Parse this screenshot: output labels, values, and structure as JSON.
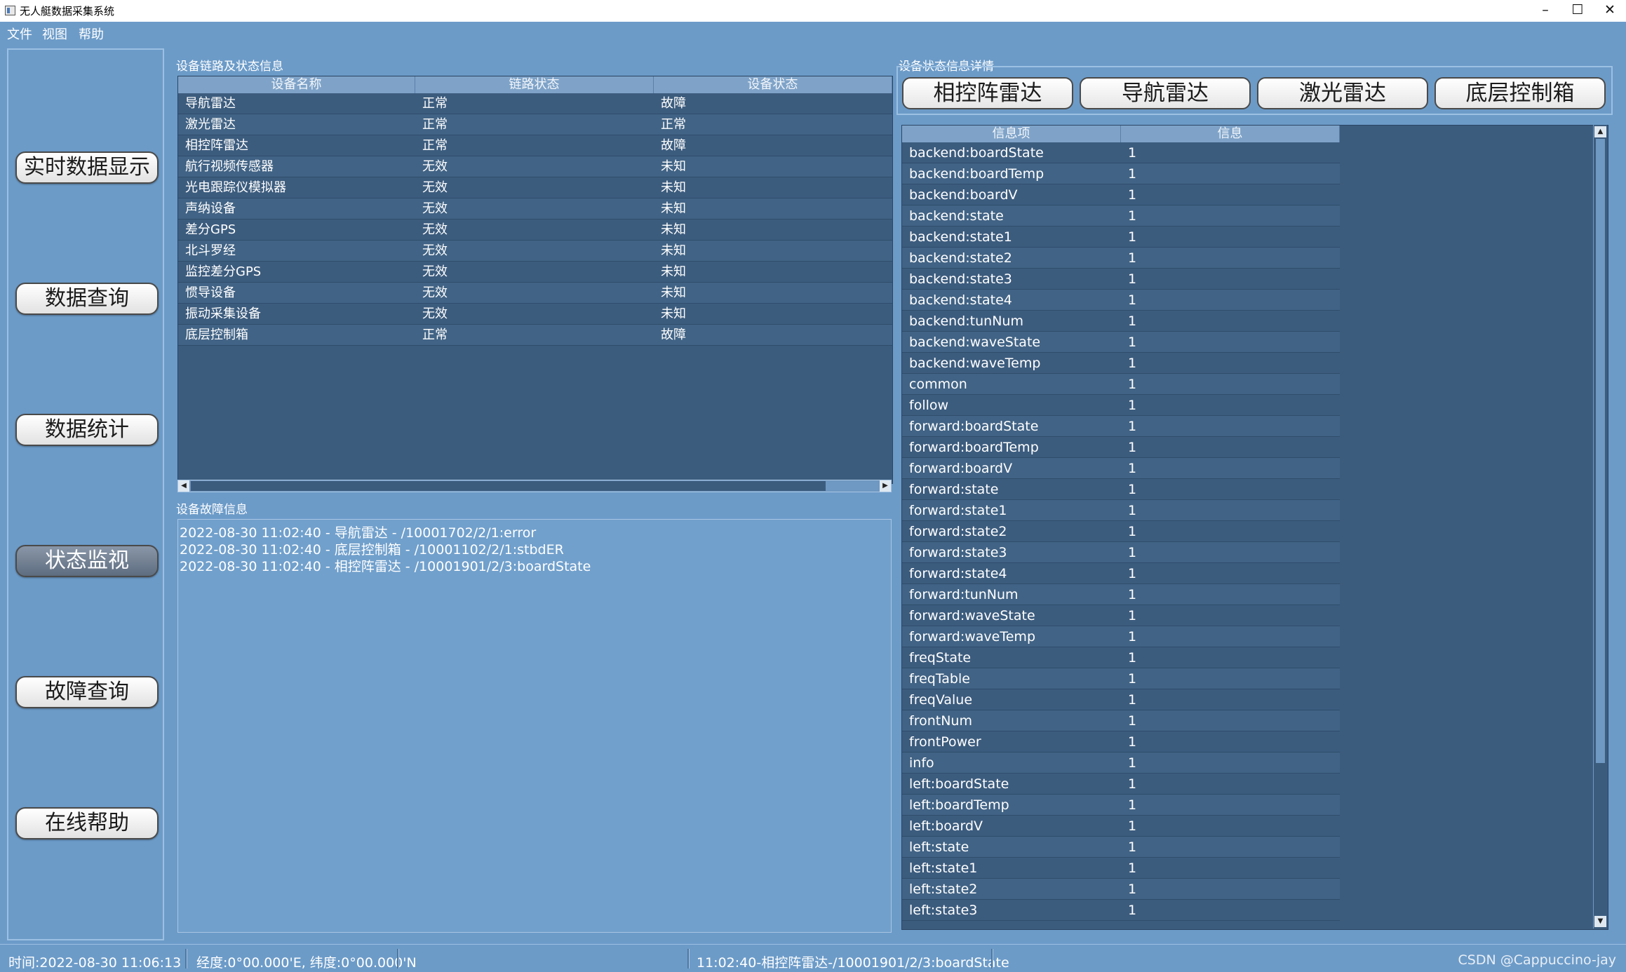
{
  "window": {
    "title": "无人艇数据采集系统",
    "controls": [
      "–",
      "☐",
      "✕"
    ]
  },
  "menu": [
    "文件",
    "视图",
    "帮助"
  ],
  "nav": {
    "buttons": [
      "实时数据显示",
      "数据查询",
      "数据统计",
      "状态监视",
      "故障查询",
      "在线帮助"
    ],
    "active": "状态监视"
  },
  "device_link": {
    "title": "设备链路及状态信息",
    "columns": [
      "设备名称",
      "链路状态",
      "设备状态"
    ],
    "rows": [
      [
        "导航雷达",
        "正常",
        "故障"
      ],
      [
        "激光雷达",
        "正常",
        "正常"
      ],
      [
        "相控阵雷达",
        "正常",
        "故障"
      ],
      [
        "航行视频传感器",
        "无效",
        "未知"
      ],
      [
        "光电跟踪仪模拟器",
        "无效",
        "未知"
      ],
      [
        "声纳设备",
        "无效",
        "未知"
      ],
      [
        "差分GPS",
        "无效",
        "未知"
      ],
      [
        "北斗罗经",
        "无效",
        "未知"
      ],
      [
        "监控差分GPS",
        "无效",
        "未知"
      ],
      [
        "惯导设备",
        "无效",
        "未知"
      ],
      [
        "振动采集设备",
        "无效",
        "未知"
      ],
      [
        "底层控制箱",
        "正常",
        "故障"
      ]
    ]
  },
  "fault_info": {
    "title": "设备故障信息",
    "lines": [
      "2022-08-30 11:02:40 - 导航雷达 - /10001702/2/1:error",
      "2022-08-30 11:02:40 - 底层控制箱 - /10001102/2/1:stbdER",
      "2022-08-30 11:02:40 - 相控阵雷达 - /10001901/2/3:boardState"
    ]
  },
  "detail": {
    "title": "设备状态信息详情",
    "tabs": [
      "相控阵雷达",
      "导航雷达",
      "激光雷达",
      "底层控制箱"
    ],
    "columns": [
      "信息项",
      "信息"
    ],
    "rows": [
      [
        "backend:boardState",
        "1"
      ],
      [
        "backend:boardTemp",
        "1"
      ],
      [
        "backend:boardV",
        "1"
      ],
      [
        "backend:state",
        "1"
      ],
      [
        "backend:state1",
        "1"
      ],
      [
        "backend:state2",
        "1"
      ],
      [
        "backend:state3",
        "1"
      ],
      [
        "backend:state4",
        "1"
      ],
      [
        "backend:tunNum",
        "1"
      ],
      [
        "backend:waveState",
        "1"
      ],
      [
        "backend:waveTemp",
        "1"
      ],
      [
        "common",
        "1"
      ],
      [
        "follow",
        "1"
      ],
      [
        "forward:boardState",
        "1"
      ],
      [
        "forward:boardTemp",
        "1"
      ],
      [
        "forward:boardV",
        "1"
      ],
      [
        "forward:state",
        "1"
      ],
      [
        "forward:state1",
        "1"
      ],
      [
        "forward:state2",
        "1"
      ],
      [
        "forward:state3",
        "1"
      ],
      [
        "forward:state4",
        "1"
      ],
      [
        "forward:tunNum",
        "1"
      ],
      [
        "forward:waveState",
        "1"
      ],
      [
        "forward:waveTemp",
        "1"
      ],
      [
        "freqState",
        "1"
      ],
      [
        "freqTable",
        "1"
      ],
      [
        "freqValue",
        "1"
      ],
      [
        "frontNum",
        "1"
      ],
      [
        "frontPower",
        "1"
      ],
      [
        "info",
        "1"
      ],
      [
        "left:boardState",
        "1"
      ],
      [
        "left:boardTemp",
        "1"
      ],
      [
        "left:boardV",
        "1"
      ],
      [
        "left:state",
        "1"
      ],
      [
        "left:state1",
        "1"
      ],
      [
        "left:state2",
        "1"
      ],
      [
        "left:state3",
        "1"
      ]
    ]
  },
  "status": {
    "time": "时间:2022-08-30 11:06:13",
    "coords": "经度:0°00.000'E, 纬度:0°00.000'N",
    "last_fault": "11:02:40-相控阵雷达-/10001901/2/3:boardState",
    "watermark": "CSDN @Cappuccino-jay"
  },
  "colors": {
    "background": "#6c9bc8",
    "table_bg": "#3c5c7e",
    "table_header": "#7fa3c8",
    "active_button": "#5f6d80"
  }
}
